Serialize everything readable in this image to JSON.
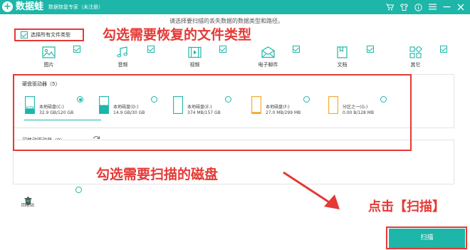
{
  "titlebar": {
    "logo_mark": "+",
    "app_name": "数据蛙",
    "app_subtitle": "数据恢复专家（未注册）",
    "icons": [
      "cart-icon",
      "shirt-icon",
      "info-icon",
      "menu-icon",
      "minimize-icon",
      "close-icon"
    ]
  },
  "subtitle": "请选择要扫描的丢失数据的数据类型和路径。",
  "select_all": {
    "label": "选择所有文件类型",
    "checked": true
  },
  "file_types": [
    {
      "key": "image",
      "label": "图片",
      "icon": "image-icon",
      "checked": true
    },
    {
      "key": "audio",
      "label": "音频",
      "icon": "music-icon",
      "checked": true
    },
    {
      "key": "video",
      "label": "视频",
      "icon": "video-icon",
      "checked": true
    },
    {
      "key": "email",
      "label": "电子邮件",
      "icon": "mail-icon",
      "checked": true
    },
    {
      "key": "document",
      "label": "文档",
      "icon": "document-icon",
      "checked": true
    },
    {
      "key": "other",
      "label": "其它",
      "icon": "grid-icon",
      "checked": true
    }
  ],
  "hard_drives": {
    "title": "硬盘驱动器（5）",
    "drives": [
      {
        "name": "本地磁盘(C:)",
        "size": "32.9 GB/120 GB",
        "selected": true,
        "fill": 0.27,
        "color": "#1db6a8"
      },
      {
        "name": "本地磁盘(D:)",
        "size": "14.9 GB/30 GB",
        "selected": false,
        "fill": 0.5,
        "color": "#1db6a8"
      },
      {
        "name": "本地磁盘(E:)",
        "size": "374 MB/157 GB",
        "selected": false,
        "fill": 0.02,
        "color": "#1db6a8"
      },
      {
        "name": "本地磁盘(F:)",
        "size": "27.0 MB/299 MB",
        "selected": false,
        "fill": 0.09,
        "color": "#f5a623"
      },
      {
        "name": "分区之一(G:)",
        "size": "0.00 B/128 MB",
        "selected": false,
        "fill": 0.0,
        "color": "#f5a623"
      }
    ]
  },
  "removable": {
    "title": "可移动驱动器（0）"
  },
  "recycle_bin": {
    "label": "回收站"
  },
  "scan_button": "扫描",
  "annotations": {
    "select_types": "勾选需要恢复的文件类型",
    "select_disk": "勾选需要扫描的磁盘",
    "click_scan": "点击【扫描】"
  },
  "colors": {
    "accent": "#1db6a8",
    "annotation": "#e53935",
    "drive_warn": "#f5a623"
  }
}
